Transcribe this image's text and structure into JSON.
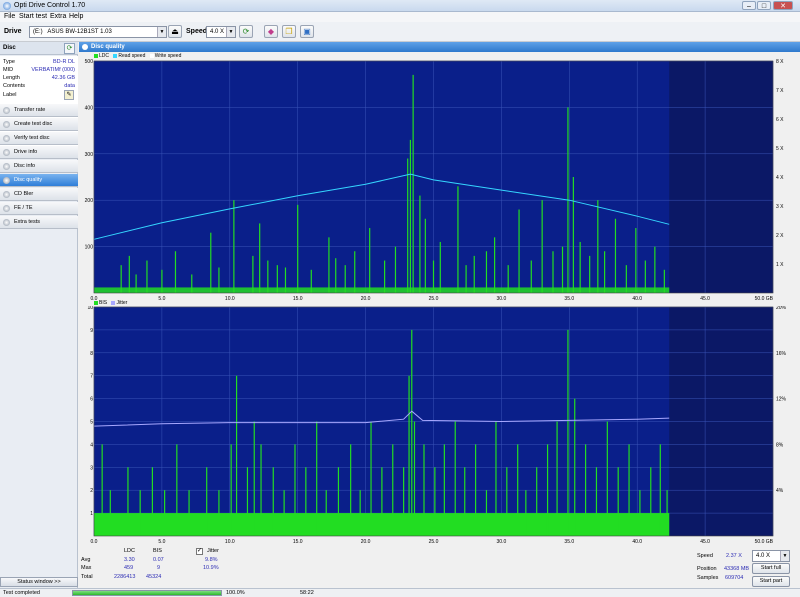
{
  "window": {
    "title": "Opti Drive Control 1.70"
  },
  "menu": [
    "File",
    "Start test",
    "Extra",
    "Help"
  ],
  "toolbar": {
    "drive_label": "Drive",
    "drive_letter": "(E:)",
    "drive_name": "ASUS BW-12B1ST 1.03",
    "speed_label": "Speed",
    "speed_value": "4.0 X"
  },
  "sidebar": {
    "disc_header": "Disc",
    "info": [
      {
        "key": "Type",
        "value": "BD-R DL"
      },
      {
        "key": "MID",
        "value": "VERBATIMf (000)"
      },
      {
        "key": "Length",
        "value": "42.36 GB"
      },
      {
        "key": "Contents",
        "value": "data"
      },
      {
        "key": "Label",
        "value": ""
      }
    ],
    "items": [
      {
        "label": "Transfer rate"
      },
      {
        "label": "Create test disc"
      },
      {
        "label": "Verify test disc"
      },
      {
        "label": "Drive info"
      },
      {
        "label": "Disc info"
      },
      {
        "label": "Disc quality"
      },
      {
        "label": "CD Bler"
      },
      {
        "label": "FE / TE"
      },
      {
        "label": "Extra tests"
      }
    ],
    "status_window": "Status window >>"
  },
  "panel": {
    "title": "Disc quality"
  },
  "colors": {
    "plot_bg": "#0a1f8a",
    "ldc": "#22dd22",
    "read": "#35d6ff",
    "jitter": "#a8a8ff"
  },
  "legend1": {
    "ldc": "LDC",
    "read": "Read speed",
    "write": "Write speed"
  },
  "legend2": {
    "bis": "BIS",
    "jitter": "Jitter"
  },
  "chart_data": [
    {
      "type": "bar",
      "name": "LDC / read speed",
      "x_ticks": [
        "0.0",
        "5.0",
        "10.0",
        "15.0",
        "20.0",
        "25.0",
        "30.0",
        "35.0",
        "40.0",
        "45.0",
        "50.0 GB"
      ],
      "y_left_ticks": [
        "100",
        "200",
        "300",
        "400",
        "500"
      ],
      "y_right_ticks": [
        "1 X",
        "2 X",
        "3 X",
        "4 X",
        "5 X",
        "6 X",
        "7 X",
        "8 X"
      ],
      "xlim": [
        0,
        50
      ],
      "ylim": [
        0,
        500
      ],
      "y2lim": [
        0,
        8
      ],
      "disc_end": 42.36,
      "ldc_spikes": [
        [
          2.0,
          60
        ],
        [
          2.6,
          80
        ],
        [
          3.1,
          40
        ],
        [
          3.9,
          70
        ],
        [
          5.0,
          50
        ],
        [
          6.0,
          90
        ],
        [
          7.2,
          40
        ],
        [
          8.6,
          130
        ],
        [
          9.2,
          55
        ],
        [
          10.3,
          200
        ],
        [
          11.7,
          80
        ],
        [
          12.2,
          150
        ],
        [
          12.8,
          70
        ],
        [
          13.5,
          60
        ],
        [
          14.1,
          55
        ],
        [
          15.0,
          190
        ],
        [
          16.0,
          50
        ],
        [
          17.3,
          120
        ],
        [
          17.8,
          75
        ],
        [
          18.5,
          60
        ],
        [
          19.2,
          90
        ],
        [
          20.3,
          140
        ],
        [
          21.4,
          70
        ],
        [
          22.2,
          100
        ],
        [
          23.1,
          290
        ],
        [
          23.3,
          330
        ],
        [
          23.5,
          470
        ],
        [
          24.0,
          210
        ],
        [
          24.4,
          160
        ],
        [
          25.0,
          70
        ],
        [
          25.5,
          110
        ],
        [
          26.8,
          230
        ],
        [
          27.4,
          60
        ],
        [
          28.0,
          80
        ],
        [
          28.9,
          90
        ],
        [
          29.5,
          120
        ],
        [
          30.5,
          60
        ],
        [
          31.3,
          180
        ],
        [
          32.2,
          70
        ],
        [
          33.0,
          200
        ],
        [
          33.8,
          90
        ],
        [
          34.5,
          100
        ],
        [
          34.9,
          400
        ],
        [
          35.3,
          250
        ],
        [
          35.8,
          110
        ],
        [
          36.5,
          80
        ],
        [
          37.1,
          200
        ],
        [
          37.6,
          90
        ],
        [
          38.4,
          160
        ],
        [
          39.2,
          60
        ],
        [
          39.9,
          140
        ],
        [
          40.6,
          70
        ],
        [
          41.3,
          100
        ],
        [
          42.0,
          50
        ]
      ],
      "read_speed": [
        [
          0,
          1.85
        ],
        [
          5,
          2.42
        ],
        [
          10,
          2.9
        ],
        [
          15,
          3.35
        ],
        [
          20,
          3.75
        ],
        [
          23.3,
          4.1
        ],
        [
          25,
          3.9
        ],
        [
          30,
          3.55
        ],
        [
          35,
          3.2
        ],
        [
          40,
          2.65
        ],
        [
          42.36,
          2.37
        ]
      ]
    },
    {
      "type": "bar",
      "name": "BIS / jitter",
      "x_ticks": [
        "0.0",
        "5.0",
        "10.0",
        "15.0",
        "20.0",
        "25.0",
        "30.0",
        "35.0",
        "40.0",
        "45.0",
        "50.0 GB"
      ],
      "y_left_ticks": [
        "1",
        "2",
        "3",
        "4",
        "5",
        "6",
        "7",
        "8",
        "9",
        "10"
      ],
      "y_right_ticks": [
        "4%",
        "8%",
        "12%",
        "16%",
        "20%"
      ],
      "xlim": [
        0,
        50
      ],
      "ylim": [
        0,
        10
      ],
      "y2lim": [
        0,
        20
      ],
      "disc_end": 42.36,
      "bis_spikes": [
        [
          0.6,
          4
        ],
        [
          1.2,
          2
        ],
        [
          2.5,
          3
        ],
        [
          3.4,
          2
        ],
        [
          4.3,
          3
        ],
        [
          5.2,
          2
        ],
        [
          6.1,
          4
        ],
        [
          7.0,
          2
        ],
        [
          8.3,
          3
        ],
        [
          9.2,
          2
        ],
        [
          10.1,
          4
        ],
        [
          10.5,
          7
        ],
        [
          11.3,
          3
        ],
        [
          11.8,
          5
        ],
        [
          12.3,
          4
        ],
        [
          13.2,
          3
        ],
        [
          14.0,
          2
        ],
        [
          14.8,
          4
        ],
        [
          15.6,
          3
        ],
        [
          16.4,
          5
        ],
        [
          17.1,
          2
        ],
        [
          18.0,
          3
        ],
        [
          18.9,
          4
        ],
        [
          19.6,
          2
        ],
        [
          20.4,
          5
        ],
        [
          21.2,
          3
        ],
        [
          22.0,
          4
        ],
        [
          22.8,
          3
        ],
        [
          23.2,
          7
        ],
        [
          23.4,
          9
        ],
        [
          23.6,
          5
        ],
        [
          24.3,
          4
        ],
        [
          25.1,
          3
        ],
        [
          25.8,
          4
        ],
        [
          26.6,
          5
        ],
        [
          27.3,
          3
        ],
        [
          28.1,
          4
        ],
        [
          28.9,
          2
        ],
        [
          29.6,
          5
        ],
        [
          30.4,
          3
        ],
        [
          31.2,
          4
        ],
        [
          31.8,
          2
        ],
        [
          32.6,
          3
        ],
        [
          33.4,
          4
        ],
        [
          34.1,
          5
        ],
        [
          34.9,
          9
        ],
        [
          35.4,
          6
        ],
        [
          36.2,
          4
        ],
        [
          37.0,
          3
        ],
        [
          37.8,
          5
        ],
        [
          38.6,
          3
        ],
        [
          39.4,
          4
        ],
        [
          40.2,
          2
        ],
        [
          41.0,
          3
        ],
        [
          41.7,
          4
        ],
        [
          42.2,
          2
        ]
      ],
      "bis_base": 1,
      "jitter": [
        [
          0,
          9.6
        ],
        [
          5,
          9.8
        ],
        [
          10,
          9.9
        ],
        [
          15,
          9.9
        ],
        [
          20,
          9.9
        ],
        [
          22.8,
          10.2
        ],
        [
          23.4,
          10.9
        ],
        [
          24.2,
          10.1
        ],
        [
          30,
          10.0
        ],
        [
          35,
          10.1
        ],
        [
          40,
          10.2
        ],
        [
          42.36,
          10.3
        ]
      ]
    }
  ],
  "stats": {
    "col_ldc": "LDC",
    "col_bis": "BIS",
    "jitter_label": "Jitter",
    "rows": [
      {
        "label": "Avg",
        "ldc": "3.30",
        "bis": "0.07",
        "jitter": "9.8%"
      },
      {
        "label": "Max",
        "ldc": "459",
        "bis": "9",
        "jitter": "10.9%"
      },
      {
        "label": "Total",
        "ldc": "2286413",
        "bis": "45324",
        "jitter": ""
      }
    ],
    "speed_label": "Speed",
    "speed_value": "2.37 X",
    "speed_select": "4.0 X",
    "position_label": "Position",
    "position_value": "43368 MB",
    "samples_label": "Samples",
    "samples_value": "609704",
    "start_full": "Start full",
    "start_part": "Start part"
  },
  "status": {
    "text": "Test completed",
    "progress_percent": 100,
    "progress_text": "100.0%",
    "time": "58:22"
  }
}
